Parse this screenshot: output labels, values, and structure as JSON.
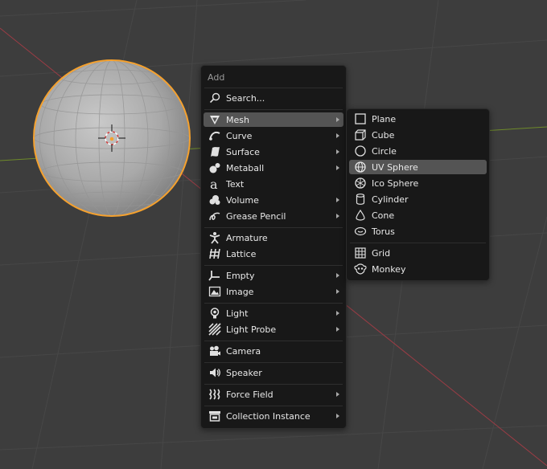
{
  "add_menu": {
    "title": "Add",
    "search_label": "Search...",
    "items": {
      "mesh": "Mesh",
      "curve": "Curve",
      "surface": "Surface",
      "metaball": "Metaball",
      "text": "Text",
      "volume": "Volume",
      "grease_pencil": "Grease Pencil",
      "armature": "Armature",
      "lattice": "Lattice",
      "empty": "Empty",
      "image": "Image",
      "light": "Light",
      "light_probe": "Light Probe",
      "camera": "Camera",
      "speaker": "Speaker",
      "force_field": "Force Field",
      "collection_instance": "Collection Instance"
    }
  },
  "mesh_submenu": {
    "items": {
      "plane": "Plane",
      "cube": "Cube",
      "circle": "Circle",
      "uv_sphere": "UV Sphere",
      "ico_sphere": "Ico Sphere",
      "cylinder": "Cylinder",
      "cone": "Cone",
      "torus": "Torus",
      "grid": "Grid",
      "monkey": "Monkey"
    },
    "highlighted": "UV Sphere"
  },
  "colors": {
    "viewport_bg": "#3d3d3d",
    "menu_bg": "#181818",
    "highlight": "#545454",
    "selection_outline": "#f5a12e",
    "x_axis": "#9b3c45",
    "y_axis": "#6e8a2a"
  }
}
